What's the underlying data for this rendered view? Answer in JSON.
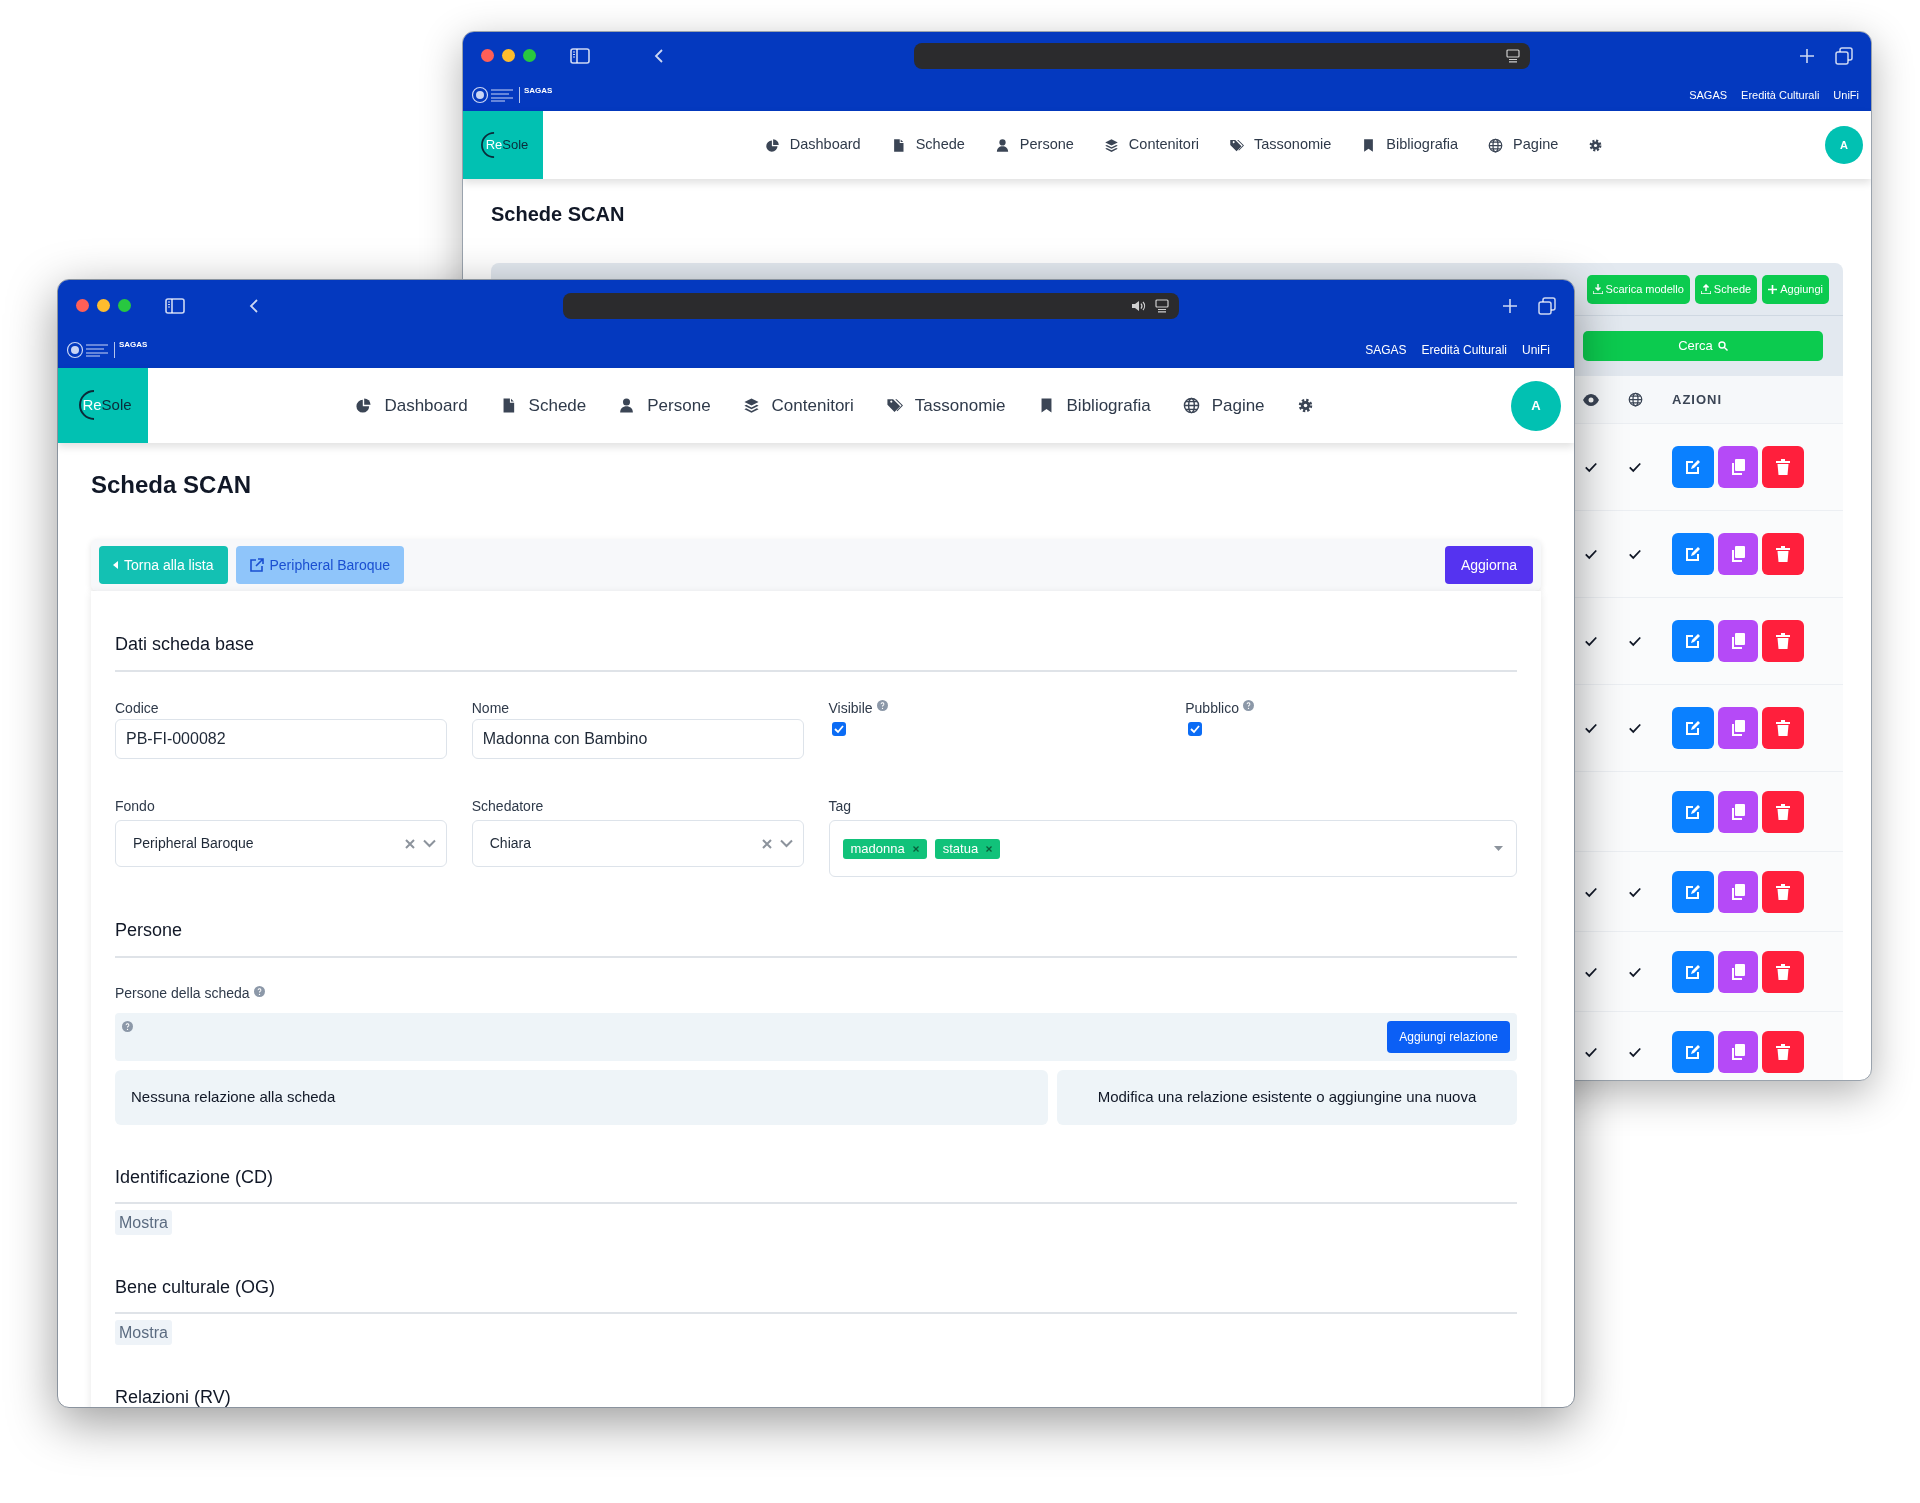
{
  "back_window": {
    "header_links": [
      "SAGAS",
      "Eredità Culturali",
      "UniFi"
    ],
    "logo_badge": "SAGAS",
    "logo": [
      "Re",
      "Sole"
    ],
    "nav": [
      "Dashboard",
      "Schede",
      "Persone",
      "Contenitori",
      "Tassonomie",
      "Bibliografia",
      "Pagine"
    ],
    "avatar": "A",
    "page_title": "Schede SCAN",
    "actions": [
      "Scarica modello",
      "Schede",
      "Aggiungi"
    ],
    "search_button": "Cerca",
    "column_header": "AZIONI",
    "rows": [
      {
        "visible": true,
        "public": true
      },
      {
        "visible": true,
        "public": true
      },
      {
        "visible": true,
        "public": true
      },
      {
        "visible": true,
        "public": true
      },
      {
        "visible": false,
        "public": false
      },
      {
        "visible": true,
        "public": true
      },
      {
        "visible": true,
        "public": true
      },
      {
        "visible": true,
        "public": true
      }
    ]
  },
  "front_window": {
    "header_links": [
      "SAGAS",
      "Eredità Culturali",
      "UniFi"
    ],
    "logo_badge": "SAGAS",
    "logo": [
      "Re",
      "Sole"
    ],
    "nav": [
      "Dashboard",
      "Schede",
      "Persone",
      "Contenitori",
      "Tassonomie",
      "Bibliografia",
      "Pagine"
    ],
    "avatar": "A",
    "page_title": "Scheda SCAN",
    "back_button": "Torna alla lista",
    "link_button": "Peripheral Baroque",
    "save_button": "Aggiorna",
    "sections": [
      {
        "kind": "fields",
        "title": "Dati scheda base",
        "fields": [
          {
            "kind": "text",
            "label": "Codice",
            "value": "PB-FI-000082"
          },
          {
            "kind": "text",
            "label": "Nome",
            "value": "Madonna con Bambino"
          },
          {
            "kind": "checkbox",
            "label": "Visibile",
            "help": true,
            "checked": true
          },
          {
            "kind": "checkbox",
            "label": "Pubblico",
            "help": true,
            "checked": true
          },
          {
            "kind": "select",
            "label": "Fondo",
            "value": "Peripheral Baroque"
          },
          {
            "kind": "select",
            "label": "Schedatore",
            "value": "Chiara"
          },
          {
            "kind": "tags",
            "label": "Tag",
            "tags": [
              "madonna",
              "statua"
            ]
          }
        ]
      },
      {
        "kind": "people",
        "title": "Persone",
        "label": "Persone della scheda",
        "help": true,
        "add_button": "Aggiungi relazione",
        "empty_text": "Nessuna relazione alla scheda",
        "hint": "Modifica una relazione esistente o aggiungine una nuova"
      },
      {
        "kind": "collapsed",
        "title": "Identificazione (CD)",
        "toggle": "Mostra"
      },
      {
        "kind": "collapsed",
        "title": "Bene culturale (OG)",
        "toggle": "Mostra"
      },
      {
        "kind": "collapsed",
        "title": "Relazioni (RV)"
      }
    ]
  }
}
